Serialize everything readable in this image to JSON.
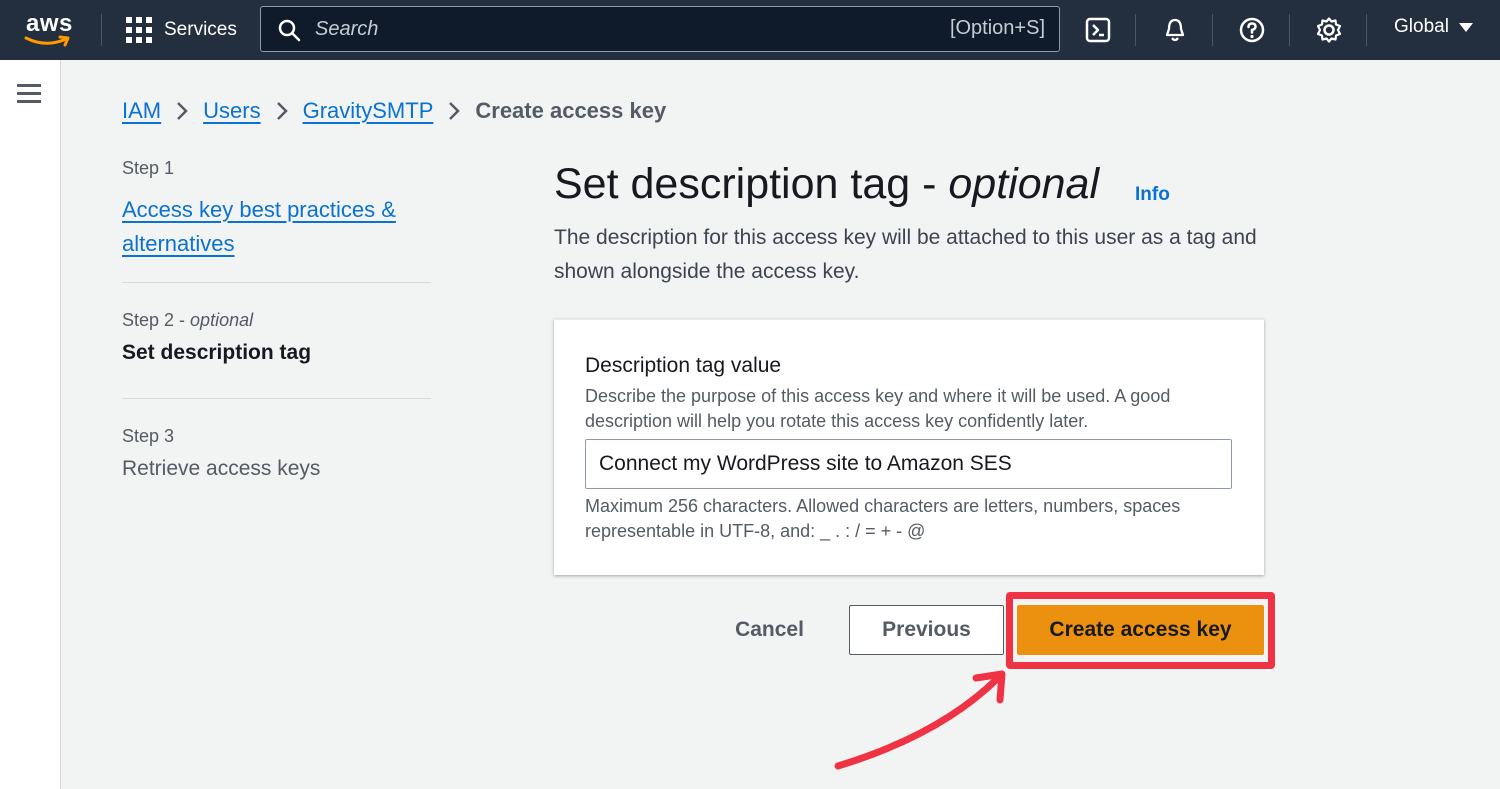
{
  "colors": {
    "topbar_bg": "#232f3e",
    "link": "#0972d3",
    "primary_button": "#ec9010",
    "highlight": "#ef3345",
    "page_bg": "#f2f3f3"
  },
  "topbar": {
    "logo_text": "aws",
    "services_label": "Services",
    "search_placeholder": "Search",
    "search_shortcut": "[Option+S]",
    "icons": [
      "cloudshell-icon",
      "bell-icon",
      "help-icon",
      "gear-icon"
    ],
    "region_label": "Global"
  },
  "breadcrumb": {
    "items": [
      {
        "label": "IAM"
      },
      {
        "label": "Users"
      },
      {
        "label": "GravitySMTP"
      }
    ],
    "current": "Create access key"
  },
  "steps": [
    {
      "number": "Step 1",
      "label": "Access key best practices & alternatives",
      "state": "link"
    },
    {
      "number": "Step 2",
      "optional": "optional",
      "label": "Set description tag",
      "state": "current"
    },
    {
      "number": "Step 3",
      "label": "Retrieve access keys",
      "state": "future"
    }
  ],
  "main": {
    "title": "Set description tag - ",
    "title_optional": "optional",
    "info_label": "Info",
    "description": "The description for this access key will be attached to this user as a tag and shown alongside the access key."
  },
  "form": {
    "label": "Description tag value",
    "description": "Describe the purpose of this access key and where it will be used. A good description will help you rotate this access key confidently later.",
    "value": "Connect my WordPress site to Amazon SES",
    "constraint": "Maximum 256 characters. Allowed characters are letters, numbers, spaces representable in UTF-8, and: _ . : / = + - @"
  },
  "actions": {
    "cancel_label": "Cancel",
    "previous_label": "Previous",
    "create_label": "Create access key"
  }
}
